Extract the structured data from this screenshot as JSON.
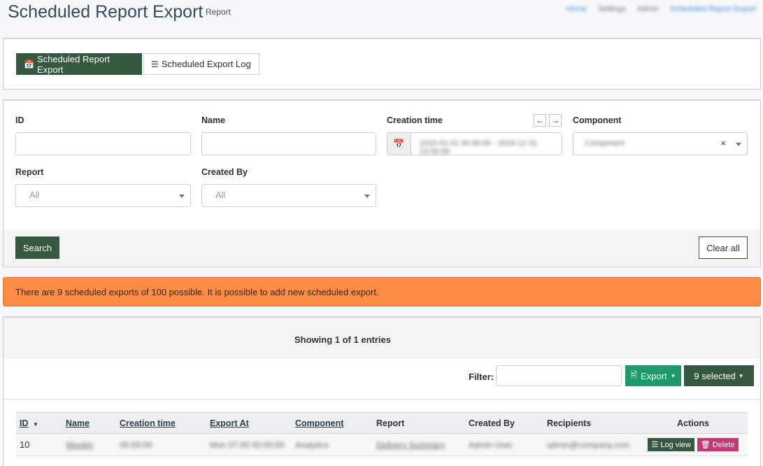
{
  "header": {
    "title": "Scheduled Report Export",
    "subtitle": "Report",
    "breadcrumb": [
      "Home",
      "Settings",
      "Admin",
      "Scheduled Report Export"
    ]
  },
  "tabs": [
    {
      "label": "Scheduled Report Export",
      "icon": "calendar-icon",
      "active": true
    },
    {
      "label": "Scheduled Export Log",
      "icon": "list-icon",
      "active": false
    }
  ],
  "form": {
    "id_label": "ID",
    "name_label": "Name",
    "creation_time_label": "Creation time",
    "creation_time_value": "2023-01-01 00:00:00 - 2023-12-31 23:59:59",
    "component_label": "Component",
    "component_value": "Component",
    "component_clear": "×",
    "report_label": "Report",
    "report_value": "All",
    "created_by_label": "Created By",
    "created_by_value": "All",
    "prev_arrow": "←",
    "next_arrow": "→",
    "search_button": "Search",
    "clear_button": "Clear all"
  },
  "alert": {
    "text": "There are 9 scheduled exports of 100 possible. It is possible to add new scheduled export.",
    "color": "#fd8c47"
  },
  "table_panel": {
    "info": "Showing 1 of 1 entries",
    "filter_label": "Filter:",
    "export_button": "Export",
    "selected_button": "9 selected"
  },
  "table": {
    "columns": [
      "ID",
      "Name",
      "Creation time",
      "Export At",
      "Component",
      "Report",
      "Created By",
      "Recipients",
      "Actions"
    ],
    "sort_indicator": "▼",
    "rows": [
      {
        "id": "10",
        "name": "Weekly",
        "creation_time": "00:00:00",
        "export_at": "Mon 07:00 00:00:00",
        "component": "Analytics",
        "report": "Delivery Summary",
        "created_by": "Admin User",
        "recipients": "admin@company.com",
        "actions": {
          "log_view": "Log view",
          "delete": "Delete"
        }
      }
    ]
  },
  "colors": {
    "primary_dark_green": "#365740",
    "export_green": "#1d9a6a",
    "delete_pink": "#c23a74",
    "title_blue": "#33495d"
  }
}
